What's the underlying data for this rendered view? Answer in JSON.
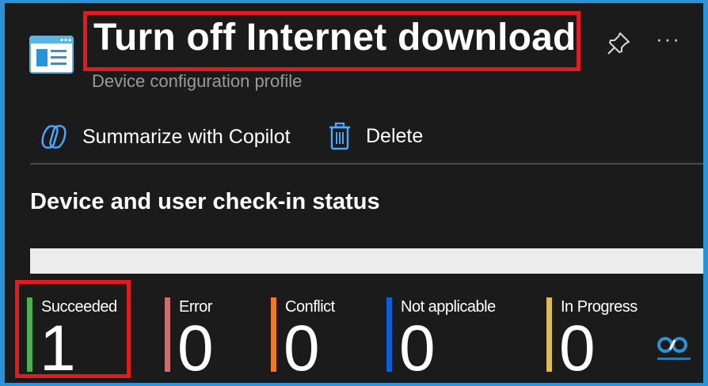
{
  "header": {
    "title": "Turn off Internet download",
    "subtitle": "Device configuration profile",
    "app_icon": "configuration-profile-icon",
    "pin_icon": "pin-icon",
    "more_label": "···"
  },
  "toolbar": {
    "copilot_label": "Summarize with Copilot",
    "delete_label": "Delete"
  },
  "section": {
    "title": "Device and user check-in status"
  },
  "progress": {
    "succeeded_fraction": 1.0,
    "color": "#ececec"
  },
  "stats": [
    {
      "label": "Succeeded",
      "value": "1",
      "color": "#4caf50"
    },
    {
      "label": "Error",
      "value": "0",
      "color": "#d06a73"
    },
    {
      "label": "Conflict",
      "value": "0",
      "color": "#f07a24"
    },
    {
      "label": "Not applicable",
      "value": "0",
      "color": "#0b5fd6"
    },
    {
      "label": "In Progress",
      "value": "0",
      "color": "#d9be56"
    }
  ],
  "colors": {
    "accent": "#2a93d8",
    "highlight": "#e21b23",
    "background": "#1b1b1b"
  }
}
